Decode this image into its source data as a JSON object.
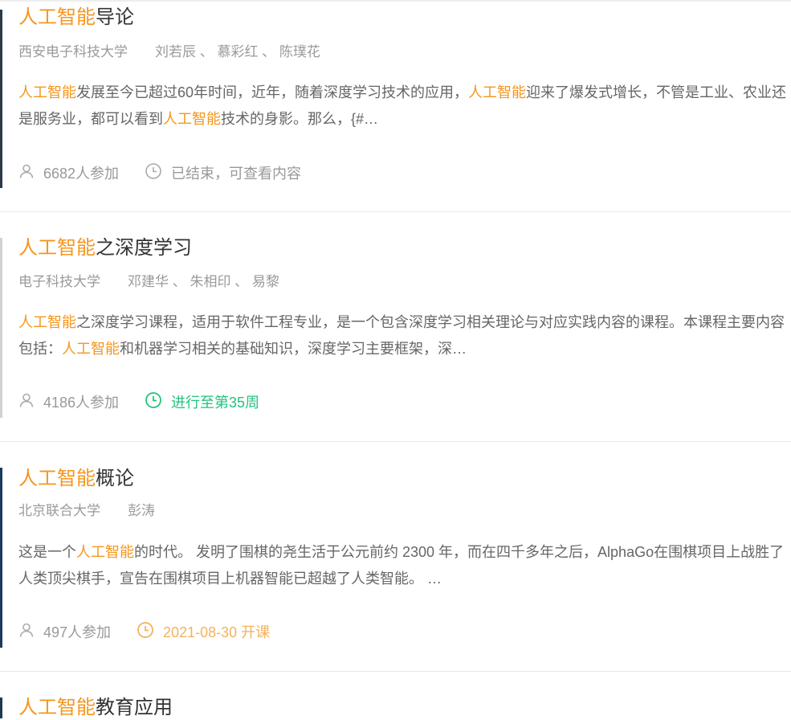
{
  "courses": [
    {
      "title_hl": "人工智能",
      "title_rest": "导论",
      "school": "西安电子科技大学",
      "teachers": "刘若辰 、 慕彩红 、 陈璞花",
      "desc": [
        {
          "t": "人工智能",
          "hl": true
        },
        {
          "t": "发展至今已超过60年时间，近年，随着深度学习技术的应用，",
          "hl": false
        },
        {
          "t": "人工智能",
          "hl": true
        },
        {
          "t": "迎来了爆发式增长，不管是工业、农业还是服务业，都可以看到",
          "hl": false
        },
        {
          "t": "人工智能",
          "hl": true
        },
        {
          "t": "技术的身影。那么，{#…",
          "hl": false
        }
      ],
      "participants": "6682人参加",
      "status": "已结束，可查看内容",
      "status_type": "ended",
      "edge_color": "#2a3a48"
    },
    {
      "title_hl": "人工智能",
      "title_rest": "之深度学习",
      "school": "电子科技大学",
      "teachers": "邓建华 、 朱相印 、 易黎",
      "desc": [
        {
          "t": "人工智能",
          "hl": true
        },
        {
          "t": "之深度学习课程，适用于软件工程专业，是一个包含深度学习相关理论与对应实践内容的课程。本课程主要内容包括：",
          "hl": false
        },
        {
          "t": "人工智能",
          "hl": true
        },
        {
          "t": "和机器学习相关的基础知识，深度学习主要框架，深…",
          "hl": false
        }
      ],
      "participants": "4186人参加",
      "status": "进行至第35周",
      "status_type": "ongoing",
      "edge_color": "#cfd3d6"
    },
    {
      "title_hl": "人工智能",
      "title_rest": "概论",
      "school": "北京联合大学",
      "teachers": "彭涛",
      "desc": [
        {
          "t": "这是一个",
          "hl": false
        },
        {
          "t": "人工智能",
          "hl": true
        },
        {
          "t": "的时代。 发明了围棋的尧生活于公元前约 2300 年，而在四千多年之后，AlphaGo在围棋项目上战胜了人类顶尖棋手，宣告在围棋项目上机器智能已超越了人类智能。 …",
          "hl": false
        }
      ],
      "participants": "497人参加",
      "status": "2021-08-30 开课",
      "status_type": "upcoming",
      "edge_color": "#1d3a5c"
    },
    {
      "title_hl": "人工智能",
      "title_rest": "教育应用",
      "edge_color": "#1f3a4c"
    }
  ],
  "icons": {
    "participants": "user-icon",
    "status": "clock-icon"
  },
  "colors": {
    "highlight": "#f5961d",
    "ongoing": "#23c27d",
    "upcoming": "#f4b25b",
    "ended": "#999999"
  }
}
